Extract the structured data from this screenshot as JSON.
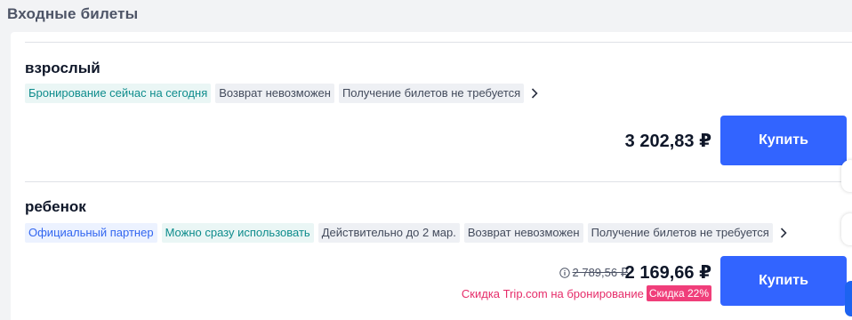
{
  "section": {
    "title": "Входные билеты"
  },
  "tickets": [
    {
      "name": "взрослый",
      "tags": [
        {
          "label": "Бронирование сейчас на сегодня",
          "color": "teal"
        },
        {
          "label": "Возврат невозможен",
          "color": "gray"
        },
        {
          "label": "Получение билетов не требуется",
          "color": "gray"
        }
      ],
      "price": "3 202,83 ₽",
      "buy_label": "Купить"
    },
    {
      "name": "ребенок",
      "tags": [
        {
          "label": "Официальный партнер",
          "color": "blue"
        },
        {
          "label": "Можно сразу использовать",
          "color": "teal"
        },
        {
          "label": "Действительно до 2 мар.",
          "color": "gray"
        },
        {
          "label": "Возврат невозможен",
          "color": "gray"
        },
        {
          "label": "Получение билетов не требуется",
          "color": "gray"
        }
      ],
      "old_price": "2 789,56 ₽",
      "price": "2 169,66 ₽",
      "discount_text": "Скидка Trip.com на бронирование",
      "discount_badge": "Скидка 22%",
      "buy_label": "Купить"
    }
  ],
  "colors": {
    "primary": "#3264ff",
    "discount": "#e62d6a",
    "teal_tag": "#0e8c8c",
    "blue_tag": "#3266f0"
  },
  "icons": {
    "expand": "chevron-right-icon",
    "info": "info-icon"
  }
}
